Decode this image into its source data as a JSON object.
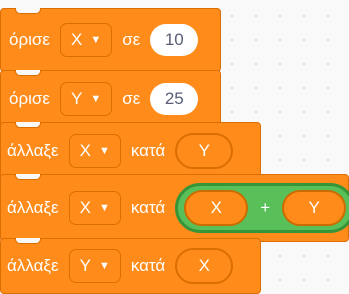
{
  "blocks": [
    {
      "keyword": "όρισε",
      "variable": "X",
      "preposition": "σε",
      "value": "10"
    },
    {
      "keyword": "όρισε",
      "variable": "Y",
      "preposition": "σε",
      "value": "25"
    },
    {
      "keyword": "άλλαξε",
      "variable": "X",
      "preposition": "κατά",
      "value": "Y"
    },
    {
      "keyword": "άλλαξε",
      "variable": "X",
      "preposition": "κατά",
      "operator": {
        "left": "X",
        "symbol": "+",
        "right": "Y"
      }
    },
    {
      "keyword": "άλλαξε",
      "variable": "Y",
      "preposition": "κατά",
      "value": "X"
    }
  ],
  "icons": {
    "caret": "caret-down-icon"
  },
  "colors": {
    "block": "#ff8c1a",
    "operator": "#59c059"
  }
}
